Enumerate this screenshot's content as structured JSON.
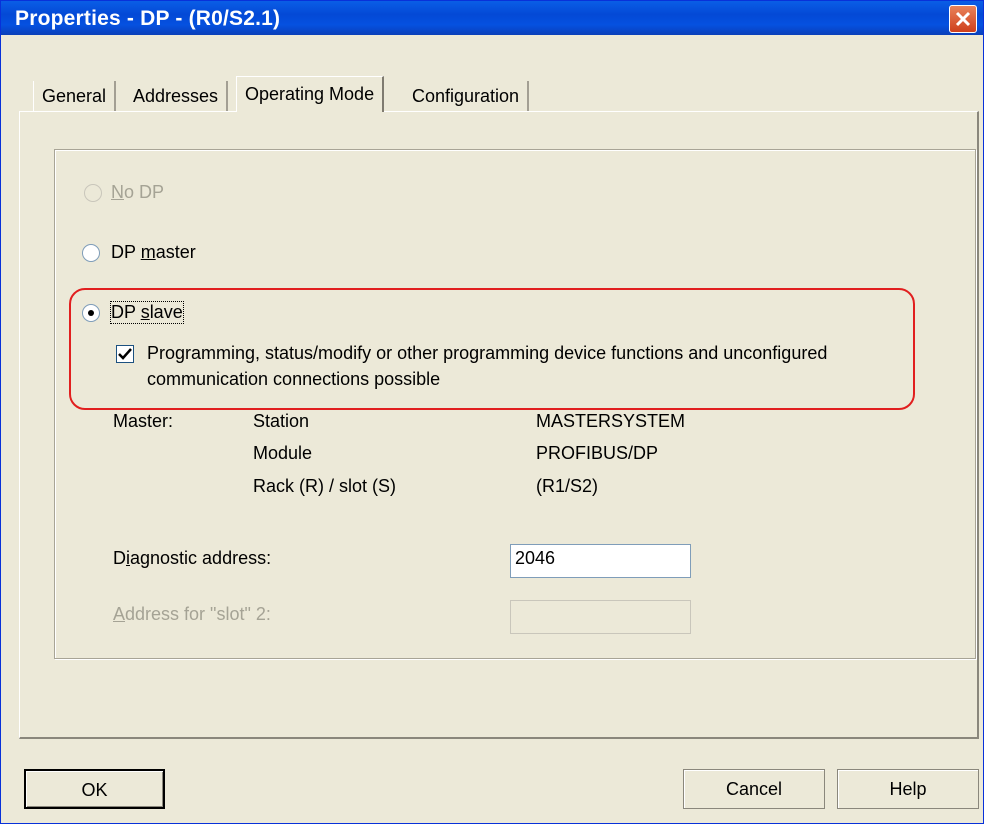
{
  "window": {
    "title": "Properties - DP - (R0/S2.1)"
  },
  "tabs": [
    {
      "label": "General"
    },
    {
      "label": "Addresses"
    },
    {
      "label": "Operating Mode"
    },
    {
      "label": "Configuration"
    }
  ],
  "active_tab": "Operating Mode",
  "mode": {
    "no_dp": {
      "label": "No DP",
      "mnemonic": "N",
      "enabled": false,
      "selected": false
    },
    "dp_master": {
      "label": "DP master",
      "mnemonic": "m",
      "enabled": true,
      "selected": false
    },
    "dp_slave": {
      "label": "DP slave",
      "mnemonic": "s",
      "enabled": true,
      "selected": true
    }
  },
  "slave_option": {
    "checked": true,
    "line1": "Programming, status/modify or other programming device functions and unconfigured",
    "line2": "communication connections possible"
  },
  "master_info": {
    "label": "Master:",
    "rows": [
      {
        "key": "Station",
        "value": "MASTERSYSTEM"
      },
      {
        "key": "Module",
        "value": "PROFIBUS/DP"
      },
      {
        "key": "Rack (R) / slot (S)",
        "value": "(R1/S2)"
      }
    ]
  },
  "diagnostic": {
    "label": "Diagnostic address:",
    "value": "2046"
  },
  "slot2": {
    "label": "Address for \"slot\" 2:",
    "value": "",
    "enabled": false
  },
  "buttons": {
    "ok": "OK",
    "cancel": "Cancel",
    "help": "Help"
  },
  "colors": {
    "title_bar": "#0449d6",
    "highlight": "#e11f1f",
    "dialog_bg": "#ece9d8"
  }
}
